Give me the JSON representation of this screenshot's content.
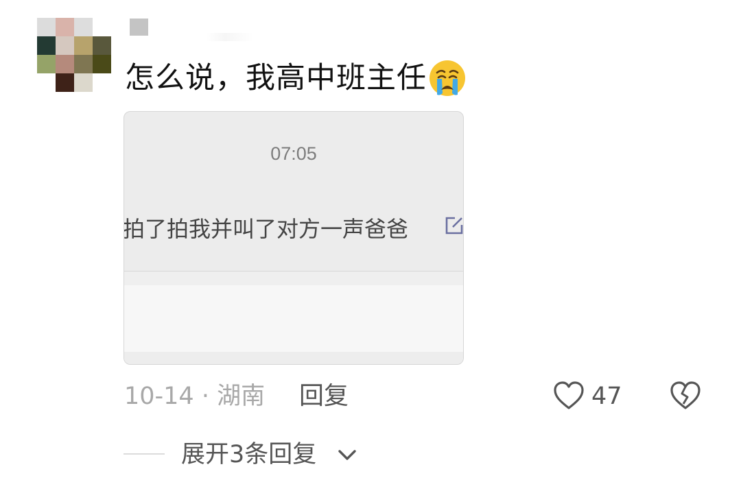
{
  "comment": {
    "text": "怎么说，我高中班主任",
    "emoji": "loudly-crying-face"
  },
  "card": {
    "time": "07:05",
    "message": "拍了拍我并叫了对方一声爸爸",
    "edit_icon": "edit-icon"
  },
  "meta": {
    "date_location": "10-14 · 湖南",
    "reply_label": "回复"
  },
  "actions": {
    "like_icon": "heart-outline-icon",
    "like_count": "47",
    "dislike_icon": "broken-heart-icon"
  },
  "expand": {
    "label": "展开3条回复",
    "icon": "chevron-down-icon"
  },
  "colors": {
    "text_primary": "#111111",
    "text_secondary": "#a8a8a8",
    "text_action": "#555555",
    "card_bg": "#ececec"
  }
}
